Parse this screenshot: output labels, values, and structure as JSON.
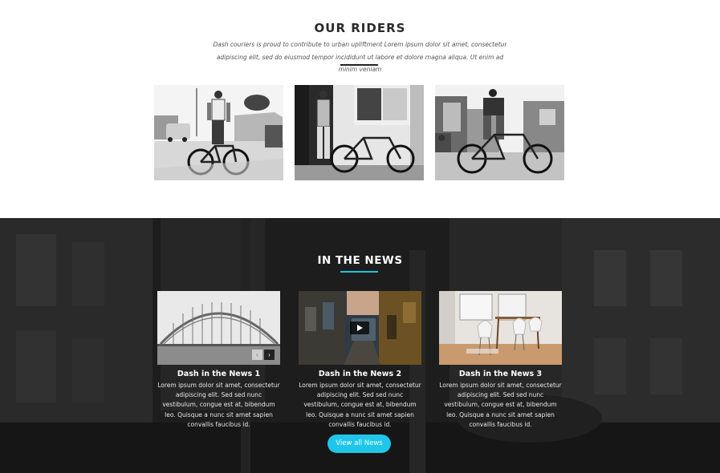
{
  "riders": {
    "title": "OUR RIDERS",
    "intro": "Dash couriers is proud to contribute to urban upliftment Lorem ipsum dolor sit amet, consectetur adipiscing elit, sed do eiusmod tempor incididunt ut labore et dolore magna aliqua. Ut enim ad minim veniam"
  },
  "news": {
    "title": "IN THE NEWS",
    "cards": [
      {
        "title": "Dash in the News 1",
        "text": "Lorem ipsum dolor sit amet, consectetur adipiscing elit. Sed sed nunc vestibulum, congue est at, bibendum leo. Quisque a nunc sit amet sapien convallis faucibus id.",
        "prev_icon": "chevron-left-icon",
        "next_icon": "chevron-right-icon"
      },
      {
        "title": "Dash in the News 2",
        "text": "Lorem ipsum dolor sit amet, consectetur adipiscing elit. Sed sed nunc vestibulum, congue est at, bibendum leo. Quisque a nunc sit amet sapien convallis faucibus id.",
        "play_icon": "play-icon"
      },
      {
        "title": "Dash in the News 3",
        "text": "Lorem ipsum dolor sit amet, consectetur adipiscing elit. Sed sed nunc vestibulum, congue est at, bibendum leo. Quisque a nunc sit amet sapien convallis faucibus id."
      }
    ],
    "view_all_label": "View all News"
  },
  "colors": {
    "accent": "#1fc6ea",
    "dark_section": "#1a1a1a",
    "heading": "#2a2a2a"
  }
}
